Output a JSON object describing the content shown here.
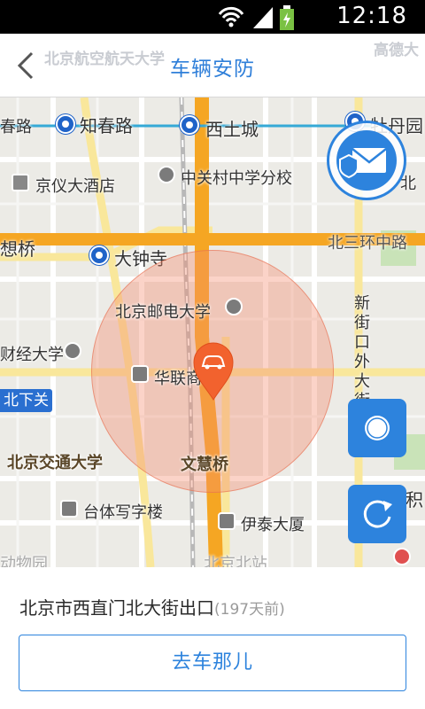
{
  "status_bar": {
    "time": "12:18"
  },
  "header": {
    "title": "车辆安防",
    "bg_map_labels": [
      "北京航空航天大学",
      "高德大"
    ]
  },
  "map": {
    "labels": {
      "chunlu": "春路",
      "zhichunlu": "知春路",
      "xitucheng": "西土城",
      "mudanyuan": "牡丹园",
      "jingyi_hotel": "京仪大酒店",
      "zhongguancun_school": "中关村中学分校",
      "bei": "北",
      "xiangqiao": "想桥",
      "dazhongsi": "大钟寺",
      "north_3rd_ring": "北三环中路",
      "bupt": "北京邮电大学",
      "xinjiekou_street": "新街口外大街",
      "caijing_univ": "财经大学",
      "hualian": "华联商",
      "beixiaguan": "北下关",
      "bjtu": "北京交通大学",
      "wenhuiqiao": "文慧桥",
      "jishuitan_ji": "积",
      "titi_office": "台体写字楼",
      "yitai_building": "伊泰大厦",
      "beijing_north_station": "北京北站",
      "zoo": "动物园"
    }
  },
  "location": {
    "address": "北京市西直门北大街出口",
    "days_ago": "(197天前)"
  },
  "actions": {
    "go_to_car": "去车那儿"
  },
  "colors": {
    "accent": "#2d83dd",
    "ring_road": "#f5a623",
    "range_circle": "#f58c6e",
    "pin": "#f2622e"
  }
}
